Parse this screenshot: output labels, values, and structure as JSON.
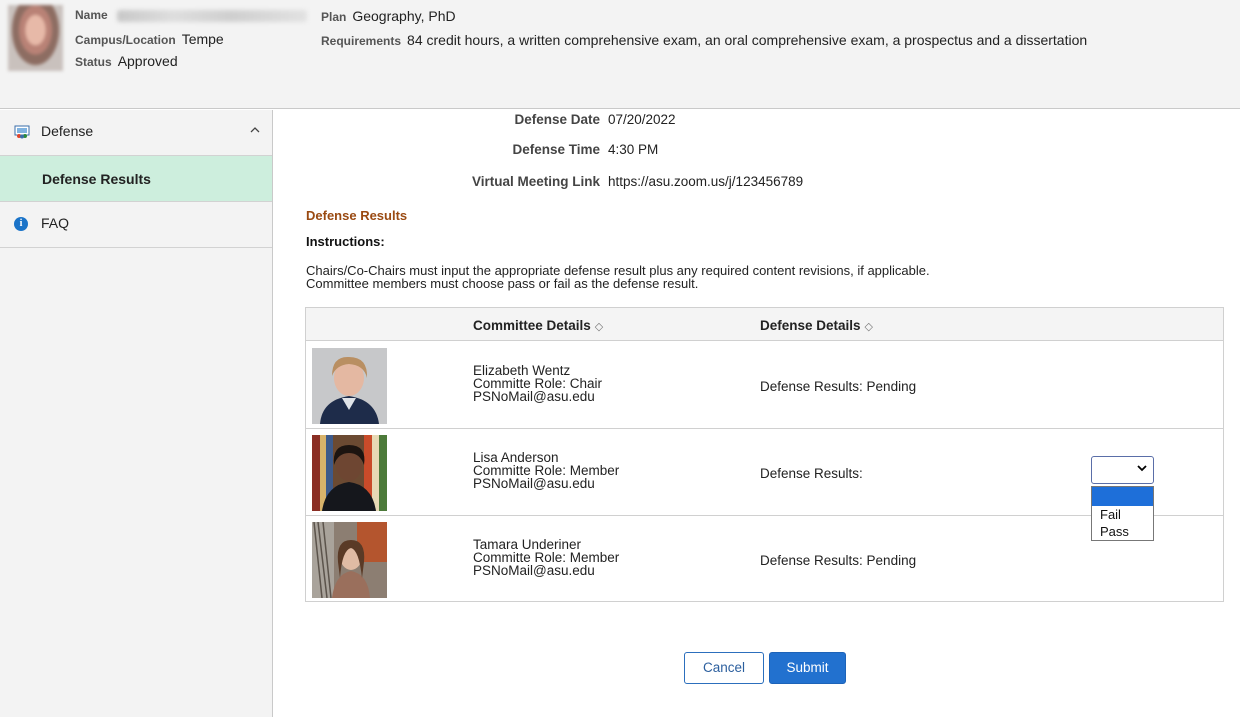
{
  "header": {
    "name_label": "Name",
    "campus_label": "Campus/Location",
    "campus_value": "Tempe",
    "status_label": "Status",
    "status_value": "Approved",
    "plan_label": "Plan",
    "plan_value": "Geography, PhD",
    "requirements_label": "Requirements",
    "requirements_value": "84 credit hours, a written comprehensive exam, an oral comprehensive exam, a prospectus and a dissertation"
  },
  "sidebar": {
    "items": [
      {
        "label": "Defense",
        "icon": "defense-icon"
      },
      {
        "label": "Defense Results"
      },
      {
        "label": "FAQ",
        "icon": "info-icon"
      }
    ]
  },
  "defense_info": {
    "date_label": "Defense Date",
    "date_value": "07/20/2022",
    "time_label": "Defense Time",
    "time_value": "4:30 PM",
    "link_label": "Virtual Meeting Link",
    "link_value": "https://asu.zoom.us/j/123456789"
  },
  "section_title": "Defense Results",
  "instructions_label": "Instructions:",
  "instructions_lines": [
    "Chairs/Co-Chairs must input the appropriate defense result plus any required content revisions, if applicable.",
    "Committee members must choose pass or fail as the defense result."
  ],
  "grid": {
    "col_committee": "Committee Details",
    "col_defense": "Defense Details",
    "sort_icon": "◇",
    "rows": [
      {
        "name": "Elizabeth Wentz",
        "role": "Committe Role: Chair",
        "email": "PSNoMail@asu.edu",
        "result": "Defense Results: Pending"
      },
      {
        "name": "Lisa Anderson",
        "role": "Committe Role: Member",
        "email": "PSNoMail@asu.edu",
        "result": "Defense Results:"
      },
      {
        "name": "Tamara Underiner",
        "role": "Committe Role: Member",
        "email": "PSNoMail@asu.edu",
        "result": "Defense Results: Pending"
      }
    ]
  },
  "dropdown": {
    "selected": "",
    "options": [
      "",
      "Fail",
      "Pass"
    ]
  },
  "buttons": {
    "cancel": "Cancel",
    "submit": "Submit"
  },
  "colors": {
    "accent": "#2271cf",
    "active_nav": "#cdeedd",
    "section_title": "#9a4a12"
  }
}
